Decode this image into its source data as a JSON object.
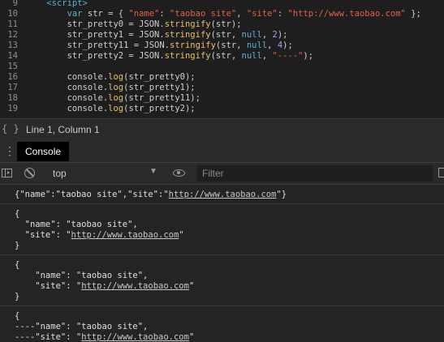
{
  "editor": {
    "lines": [
      {
        "n": "9",
        "indent": "    ",
        "tokens": [
          {
            "t": "<script>",
            "c": "tag"
          }
        ]
      },
      {
        "n": "10",
        "indent": "        ",
        "tokens": [
          {
            "t": "var ",
            "c": "kw"
          },
          {
            "t": "str = { ",
            "c": "plain"
          },
          {
            "t": "\"name\"",
            "c": "str"
          },
          {
            "t": ": ",
            "c": "plain"
          },
          {
            "t": "\"taobao site\"",
            "c": "str"
          },
          {
            "t": ", ",
            "c": "plain"
          },
          {
            "t": "\"site\"",
            "c": "str"
          },
          {
            "t": ": ",
            "c": "plain"
          },
          {
            "t": "\"http://www.taobao.com\"",
            "c": "str"
          },
          {
            "t": " };",
            "c": "plain"
          }
        ]
      },
      {
        "n": "11",
        "indent": "        ",
        "tokens": [
          {
            "t": "str_pretty0 = JSON.",
            "c": "plain"
          },
          {
            "t": "stringify",
            "c": "fn"
          },
          {
            "t": "(str);",
            "c": "plain"
          }
        ]
      },
      {
        "n": "12",
        "indent": "        ",
        "tokens": [
          {
            "t": "str_pretty1 = JSON.",
            "c": "plain"
          },
          {
            "t": "stringify",
            "c": "fn"
          },
          {
            "t": "(str, ",
            "c": "plain"
          },
          {
            "t": "null",
            "c": "kw"
          },
          {
            "t": ", ",
            "c": "plain"
          },
          {
            "t": "2",
            "c": "num"
          },
          {
            "t": ");",
            "c": "plain"
          }
        ]
      },
      {
        "n": "13",
        "indent": "        ",
        "tokens": [
          {
            "t": "str_pretty11 = JSON.",
            "c": "plain"
          },
          {
            "t": "stringify",
            "c": "fn"
          },
          {
            "t": "(str, ",
            "c": "plain"
          },
          {
            "t": "null",
            "c": "kw"
          },
          {
            "t": ", ",
            "c": "plain"
          },
          {
            "t": "4",
            "c": "num"
          },
          {
            "t": ");",
            "c": "plain"
          }
        ]
      },
      {
        "n": "14",
        "indent": "        ",
        "tokens": [
          {
            "t": "str_pretty2 = JSON.",
            "c": "plain"
          },
          {
            "t": "stringify",
            "c": "fn"
          },
          {
            "t": "(str, ",
            "c": "plain"
          },
          {
            "t": "null",
            "c": "kw"
          },
          {
            "t": ", ",
            "c": "plain"
          },
          {
            "t": "\"----\"",
            "c": "str"
          },
          {
            "t": ");",
            "c": "plain"
          }
        ]
      },
      {
        "n": "15",
        "indent": "",
        "tokens": []
      },
      {
        "n": "16",
        "indent": "        ",
        "tokens": [
          {
            "t": "console.",
            "c": "plain"
          },
          {
            "t": "log",
            "c": "fn"
          },
          {
            "t": "(str_pretty0);",
            "c": "plain"
          }
        ]
      },
      {
        "n": "17",
        "indent": "        ",
        "tokens": [
          {
            "t": "console.",
            "c": "plain"
          },
          {
            "t": "log",
            "c": "fn"
          },
          {
            "t": "(str_pretty1);",
            "c": "plain"
          }
        ]
      },
      {
        "n": "18",
        "indent": "        ",
        "tokens": [
          {
            "t": "console.",
            "c": "plain"
          },
          {
            "t": "log",
            "c": "fn"
          },
          {
            "t": "(str_pretty11);",
            "c": "plain"
          }
        ]
      },
      {
        "n": "19",
        "indent": "        ",
        "tokens": [
          {
            "t": "console.",
            "c": "plain"
          },
          {
            "t": "log",
            "c": "fn"
          },
          {
            "t": "(str_pretty2);",
            "c": "plain"
          }
        ]
      }
    ]
  },
  "status_bar": {
    "braces_icon": "{ }",
    "position_text": "Line 1, Column 1"
  },
  "drawer": {
    "menu_icon": "⋮",
    "tab_label": "Console"
  },
  "toolbar": {
    "context_value": "top",
    "filter_placeholder": "Filter",
    "icons": [
      "sidebar-toggle-icon",
      "clear-icon",
      "dropdown-icon",
      "eye-icon"
    ]
  },
  "console": {
    "messages": [
      {
        "lines": [
          [
            {
              "t": "{\"name\":\"taobao site\",\"site\":\""
            },
            {
              "t": "http://www.taobao.com",
              "link": true
            },
            {
              "t": "\"}"
            }
          ]
        ]
      },
      {
        "lines": [
          [
            {
              "t": "{"
            }
          ],
          [
            {
              "t": "  \"name\": \"taobao site\","
            }
          ],
          [
            {
              "t": "  \"site\": \""
            },
            {
              "t": "http://www.taobao.com",
              "link": true
            },
            {
              "t": "\""
            }
          ],
          [
            {
              "t": "}"
            }
          ]
        ]
      },
      {
        "lines": [
          [
            {
              "t": "{"
            }
          ],
          [
            {
              "t": "    \"name\": \"taobao site\","
            }
          ],
          [
            {
              "t": "    \"site\": \""
            },
            {
              "t": "http://www.taobao.com",
              "link": true
            },
            {
              "t": "\""
            }
          ],
          [
            {
              "t": "}"
            }
          ]
        ]
      },
      {
        "lines": [
          [
            {
              "t": "{"
            }
          ],
          [
            {
              "t": "----\"name\": \"taobao site\","
            }
          ],
          [
            {
              "t": "----\"site\": \""
            },
            {
              "t": "http://www.taobao.com",
              "link": true
            },
            {
              "t": "\""
            }
          ],
          [
            {
              "t": "}"
            }
          ]
        ]
      }
    ]
  }
}
